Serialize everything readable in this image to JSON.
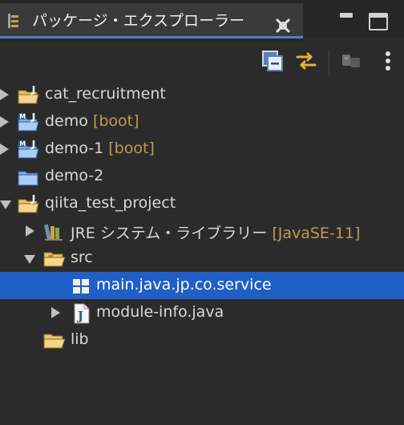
{
  "tab": {
    "title": "パッケージ・エクスプローラー"
  },
  "toolbar": {
    "buttons": [
      "collapse-all",
      "link-with-editor",
      "filters",
      "view-menu"
    ]
  },
  "tree": {
    "items": [
      {
        "label": "cat_recruitment",
        "decoration": ""
      },
      {
        "label": "demo",
        "decoration": "[boot]"
      },
      {
        "label": "demo-1",
        "decoration": "[boot]"
      },
      {
        "label": "demo-2",
        "decoration": ""
      },
      {
        "label": "qiita_test_project",
        "decoration": ""
      },
      {
        "label": "JRE システム・ライブラリー",
        "decoration": "[JavaSE-11]"
      },
      {
        "label": "src",
        "decoration": ""
      },
      {
        "label": "main.java.jp.co.service",
        "decoration": ""
      },
      {
        "label": "module-info.java",
        "decoration": ""
      },
      {
        "label": "lib",
        "decoration": ""
      }
    ]
  },
  "colors": {
    "selection": "#1f5fc6",
    "decoration": "#c39a4e",
    "tab_underline": "#4a82c4"
  }
}
